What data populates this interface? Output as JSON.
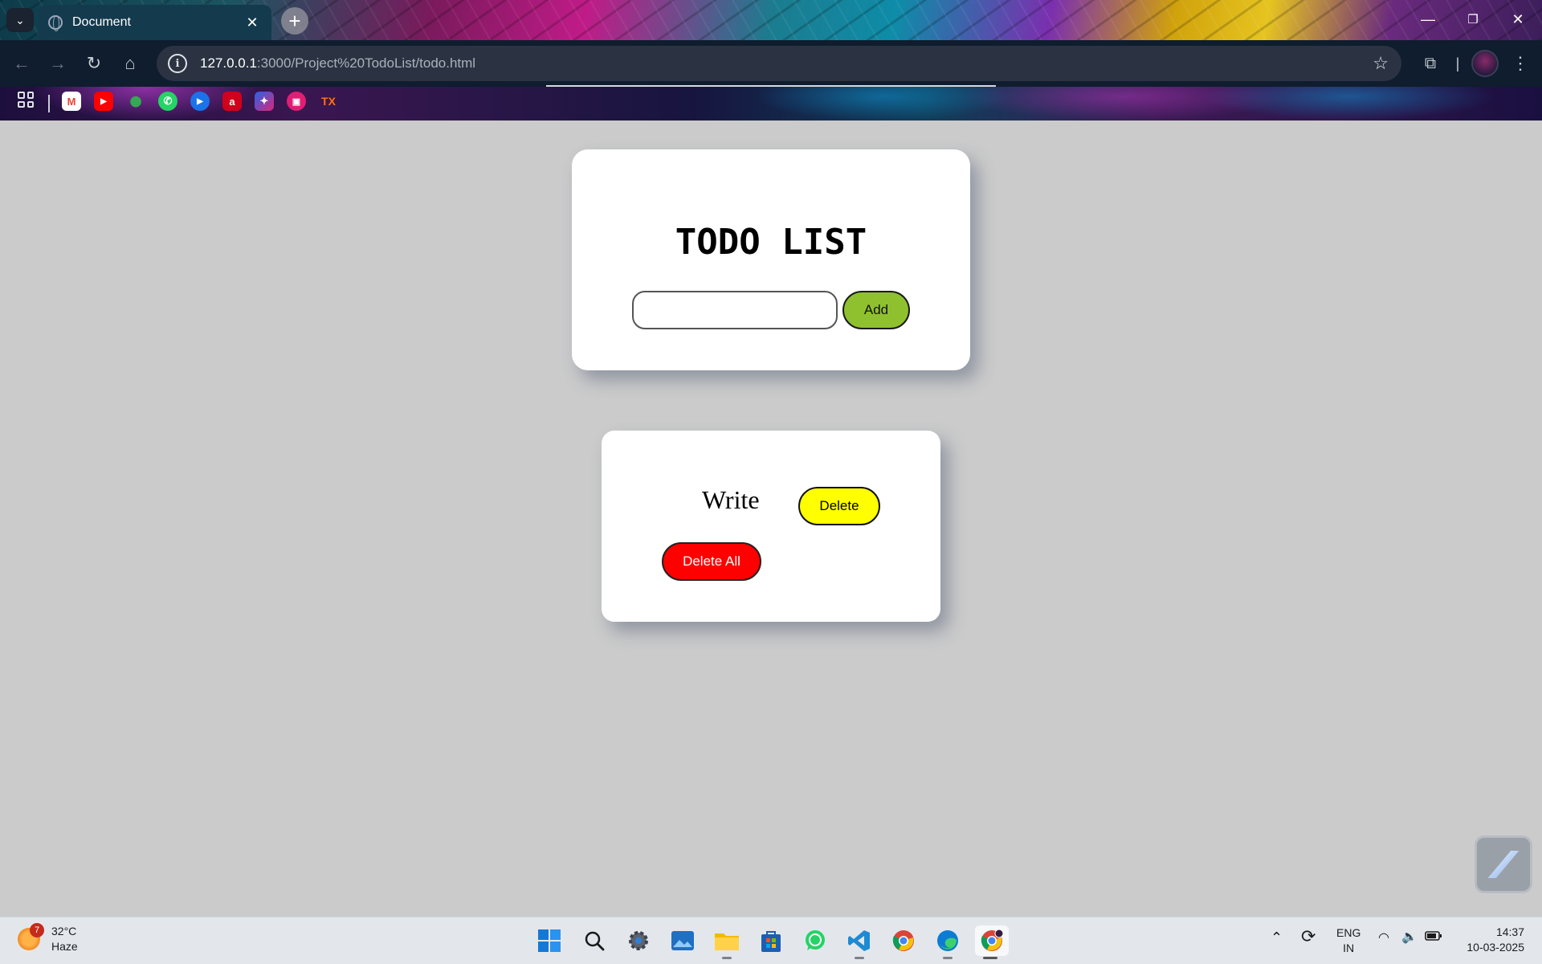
{
  "browser": {
    "tab_title": "Document",
    "tab_close": "✕",
    "new_tab": "+",
    "url_host": "127.0.0.1",
    "url_rest": ":3000/Project%20TodoList/todo.html",
    "window_controls": [
      "—",
      "❐",
      "✕"
    ]
  },
  "bookmarks": [
    {
      "name": "gmail",
      "label": "M",
      "color": "#ea4335"
    },
    {
      "name": "youtube",
      "label": "▶",
      "color": "#ff0000"
    },
    {
      "name": "maps",
      "label": "⬤",
      "color": "#34a853"
    },
    {
      "name": "whatsapp",
      "label": "✆",
      "color": "#25d366"
    },
    {
      "name": "play",
      "label": "▶",
      "color": "#1a73e8"
    },
    {
      "name": "airtel",
      "label": "a",
      "color": "#d1001c"
    },
    {
      "name": "spark",
      "label": "✦",
      "color": "#6d28d9"
    },
    {
      "name": "calendar",
      "label": "▣",
      "color": "#e11d74"
    },
    {
      "name": "tx",
      "label": "TX",
      "color": "#f97316"
    }
  ],
  "todo": {
    "heading": "TODO LIST",
    "input_value": "",
    "add_label": "Add",
    "tasks": [
      {
        "text": "Write",
        "delete_label": "Delete"
      }
    ],
    "delete_all_label": "Delete All"
  },
  "colors": {
    "page_bg": "#cbcbcb",
    "add_button": "#8fc12e",
    "delete_button": "#ffff00",
    "delete_all_button": "#ff0000"
  },
  "taskbar": {
    "weather_badge": "7",
    "temperature": "32°C",
    "condition": "Haze",
    "language_1": "ENG",
    "language_2": "IN",
    "time": "14:37",
    "date": "10-03-2025"
  }
}
